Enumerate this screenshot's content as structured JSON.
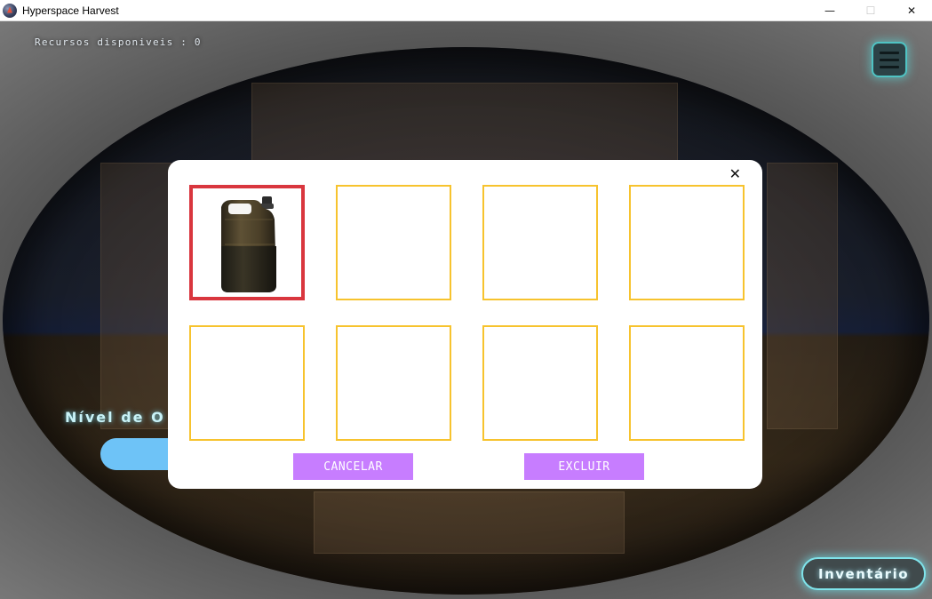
{
  "window": {
    "title": "Hyperspace Harvest",
    "controls": {
      "minimize": "—",
      "maximize": "☐",
      "close": "✕"
    }
  },
  "hud": {
    "resources_text": "Recursos disponiveis : 0",
    "level_label": "Nível de O",
    "inventory_button": "Inventário",
    "menu_icon": "hamburger-menu-icon"
  },
  "modal": {
    "close_label": "✕",
    "slots": [
      {
        "item": "jerrycan",
        "selected": true
      },
      {
        "item": "",
        "selected": false
      },
      {
        "item": "",
        "selected": false
      },
      {
        "item": "",
        "selected": false
      },
      {
        "item": "",
        "selected": false
      },
      {
        "item": "",
        "selected": false
      },
      {
        "item": "",
        "selected": false
      },
      {
        "item": "",
        "selected": false
      }
    ],
    "cancel_button": "CANCELAR",
    "delete_button": "EXCLUIR"
  },
  "colors": {
    "slot_border": "#f7c32e",
    "selected_border": "#d9363e",
    "button_bg": "#c77dff",
    "neon_accent": "#7fe3ea",
    "level_bar": "#6ec3f7"
  }
}
